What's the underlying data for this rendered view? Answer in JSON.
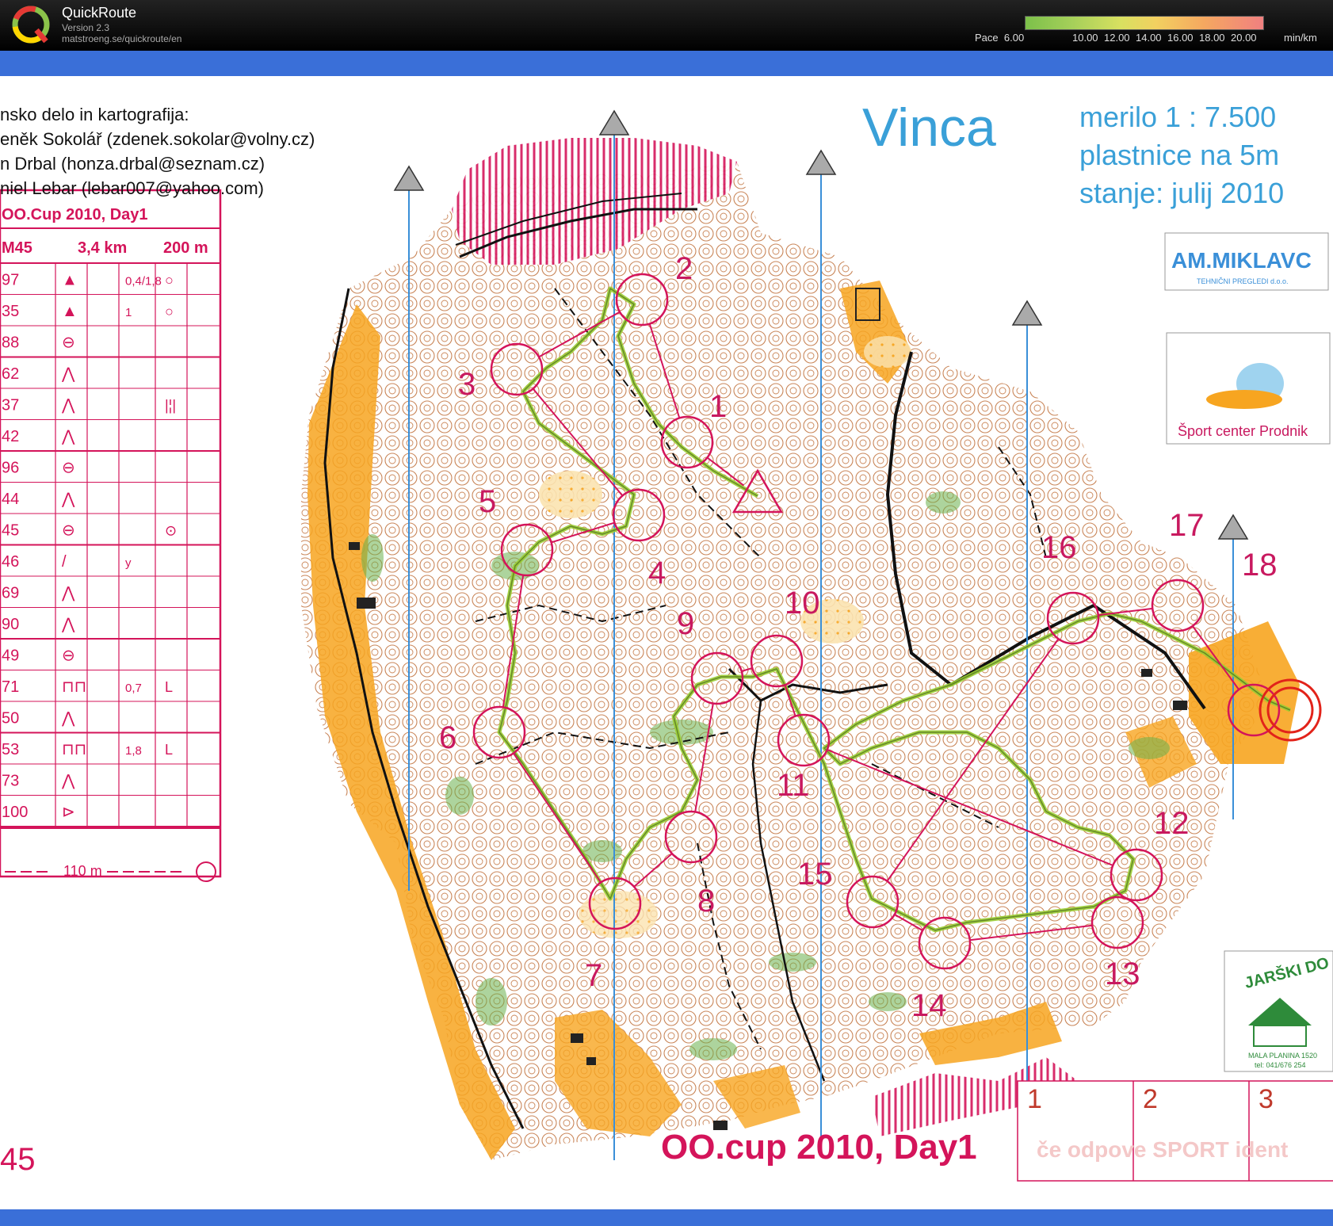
{
  "app": {
    "name": "QuickRoute",
    "version": "Version 2.3",
    "url": "matstroeng.se/quickroute/en"
  },
  "pace_legend": {
    "label": "Pace",
    "ticks": [
      "6.00",
      "10.00",
      "12.00",
      "14.00",
      "16.00",
      "18.00",
      "20.00"
    ],
    "unit": "min/km"
  },
  "credits": {
    "heading": "nsko delo in kartografija:",
    "lines": [
      "eněk Sokolář (zdenek.sokolar@volny.cz)",
      "n Drbal (honza.drbal@seznam.cz)",
      "niel Lebar (lebar007@yahoo.com)"
    ]
  },
  "map_info": {
    "name": "Vinca",
    "scale": "merilo 1 : 7.500",
    "contours": "plastnice na 5m",
    "state": "stanje: julij 2010"
  },
  "event_title": "OO.cup 2010, Day1",
  "course_label": "45",
  "description_sheet": {
    "title": "OO.Cup 2010, Day1",
    "header": [
      "M45",
      "3,4 km",
      "200 m"
    ],
    "rows": [
      {
        "code": "97",
        "sym": "▲",
        "extra": "0,4/1,8",
        "end": "○"
      },
      {
        "code": "35",
        "sym": "▲",
        "extra": "1",
        "end": "○"
      },
      {
        "code": "88",
        "sym": "⊖",
        "extra": "",
        "end": ""
      },
      {
        "code": "62",
        "sym": "⋀",
        "extra": "",
        "end": ""
      },
      {
        "code": "37",
        "sym": "⋀",
        "extra": "",
        "end": "|¦|"
      },
      {
        "code": "42",
        "sym": "⋀",
        "extra": "",
        "end": ""
      },
      {
        "code": "96",
        "sym": "⊖",
        "extra": "",
        "end": ""
      },
      {
        "code": "44",
        "sym": "⋀",
        "extra": "",
        "end": ""
      },
      {
        "code": "45",
        "sym": "⊖",
        "extra": "",
        "end": "⊙"
      },
      {
        "code": "46",
        "sym": "/",
        "extra": "y",
        "end": ""
      },
      {
        "code": "69",
        "sym": "⋀",
        "extra": "",
        "end": ""
      },
      {
        "code": "90",
        "sym": "⋀",
        "extra": "",
        "end": ""
      },
      {
        "code": "49",
        "sym": "⊖",
        "extra": "",
        "end": ""
      },
      {
        "code": "71",
        "sym": "⊓⊓",
        "extra": "0,7",
        "end": "L"
      },
      {
        "code": "50",
        "sym": "⋀",
        "extra": "",
        "end": ""
      },
      {
        "code": "53",
        "sym": "⊓⊓",
        "extra": "1,8",
        "end": "L"
      },
      {
        "code": "73",
        "sym": "⋀",
        "extra": "",
        "end": ""
      },
      {
        "code": "100",
        "sym": "⊳",
        "extra": "",
        "end": ""
      }
    ],
    "finish": "110 m"
  },
  "sponsors": {
    "miklavc": "AM.MIKLAVC",
    "miklavc_sub": "TEHNIČNI PREGLEDI d.o.o.",
    "prodnik": "Šport center Prodnik",
    "jarski": "JARŠKI DO",
    "jarski_addr": "MALA PLANINA 1520",
    "jarski_tel": "tel: 041/676 254"
  },
  "punch_card": {
    "boxes": [
      "1",
      "2",
      "3"
    ],
    "note": "če odpove SPORT ident"
  },
  "controls": [
    {
      "num": "1"
    },
    {
      "num": "2"
    },
    {
      "num": "3"
    },
    {
      "num": "4"
    },
    {
      "num": "5"
    },
    {
      "num": "6"
    },
    {
      "num": "7"
    },
    {
      "num": "8"
    },
    {
      "num": "9"
    },
    {
      "num": "10"
    },
    {
      "num": "11"
    },
    {
      "num": "12"
    },
    {
      "num": "13"
    },
    {
      "num": "14"
    },
    {
      "num": "15"
    },
    {
      "num": "16"
    },
    {
      "num": "17"
    },
    {
      "num": "18"
    }
  ],
  "colors": {
    "course": "#d4145a",
    "route": "#9acd32",
    "open_land": "#f7a520",
    "contour": "#b5651d",
    "map_bg": "#ffffff",
    "frame": "#3a6fd8"
  }
}
